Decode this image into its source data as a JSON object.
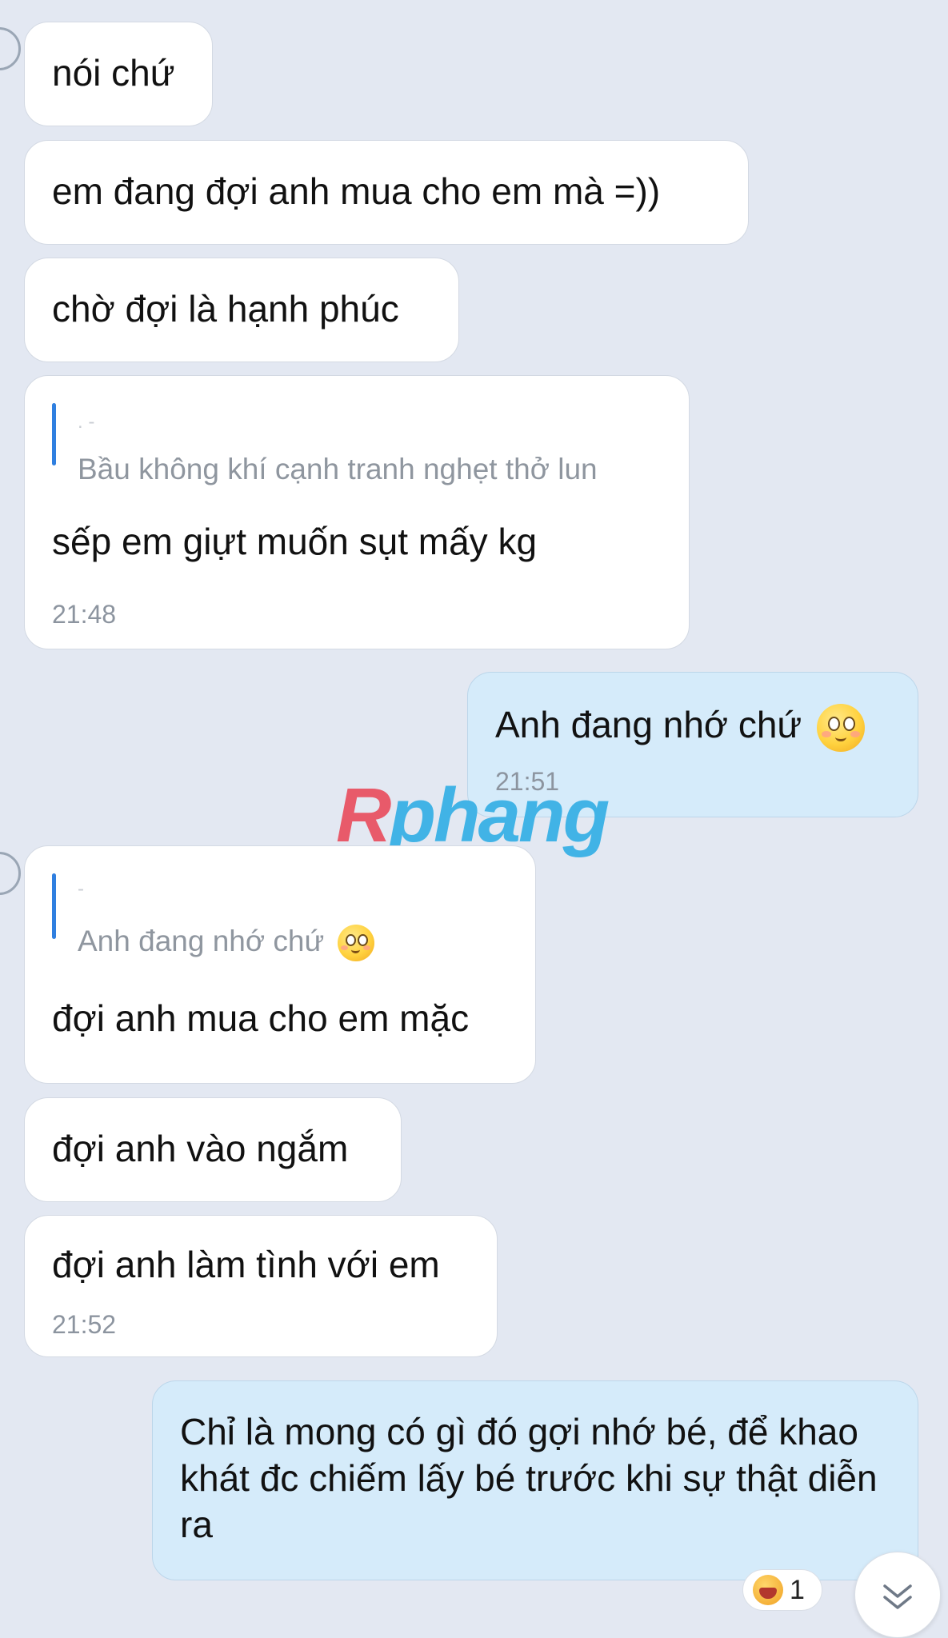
{
  "messages": [
    {
      "text": "nói chứ"
    },
    {
      "text": "em đang đợi anh mua cho em mà =))"
    },
    {
      "text": "chờ đợi là hạnh phúc"
    },
    {
      "quote_name": ". -",
      "quote_text": "Bầu không khí cạnh tranh nghẹt thở lun",
      "text": "sếp em giựt muốn sụt mấy kg",
      "time": "21:48"
    },
    {
      "text": "Anh đang nhớ chứ",
      "emoji": "shy-smiling-face",
      "time": "21:51"
    },
    {
      "quote_name": "-",
      "quote_text": "Anh đang nhớ chứ",
      "quote_emoji": "shy-smiling-face",
      "text": "đợi anh mua cho em mặc"
    },
    {
      "text": "đợi anh vào ngắm"
    },
    {
      "text": "đợi anh làm tình với em",
      "time": "21:52"
    },
    {
      "text": "Chỉ là mong có gì đó gợi nhớ bé, để khao khát đc chiếm lấy bé trước khi sự thật diễn ra"
    }
  ],
  "watermark": {
    "part1": "R",
    "part2": "phang"
  },
  "reaction": {
    "emoji": "laughing-crying-face",
    "count": "1"
  },
  "scroll_button": {
    "icon": "double-chevron-down-icon"
  },
  "colors": {
    "background": "#e3e8f2",
    "incoming_bubble": "#ffffff",
    "outgoing_bubble": "#d5ebfa",
    "quote_bar": "#2f7fe0"
  }
}
